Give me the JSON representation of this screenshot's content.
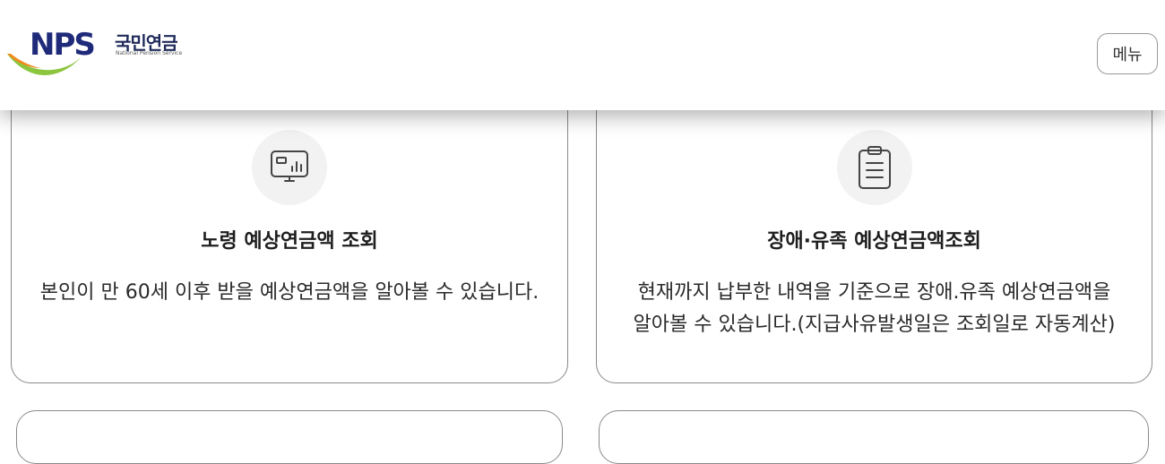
{
  "header": {
    "logo": {
      "abbr": "NPS",
      "name_ko": "국민연금",
      "name_en": "National Pension Service"
    },
    "menu_label": "메뉴"
  },
  "cards": [
    {
      "icon": "monitor-chart-icon",
      "title": "노령 예상연금액 조회",
      "description": [
        "본인이 만 60세 이후 받을 예상연금액을 알아볼 수 있습니다."
      ]
    },
    {
      "icon": "clipboard-list-icon",
      "title": "장애·유족 예상연금액조회",
      "description": [
        "현재까지 납부한 내역을 기준으로 장애.유족 예상연금액을",
        "알아볼 수 있습니다.(지급사유발생일은 조회일로 자동계산)"
      ]
    }
  ],
  "colors": {
    "brand_navy": "#1f2a7a",
    "logo_orange": "#f08a1c",
    "logo_green": "#8cc63f",
    "card_border": "#8a8a8a",
    "icon_circle_bg": "#f2f2f2"
  }
}
